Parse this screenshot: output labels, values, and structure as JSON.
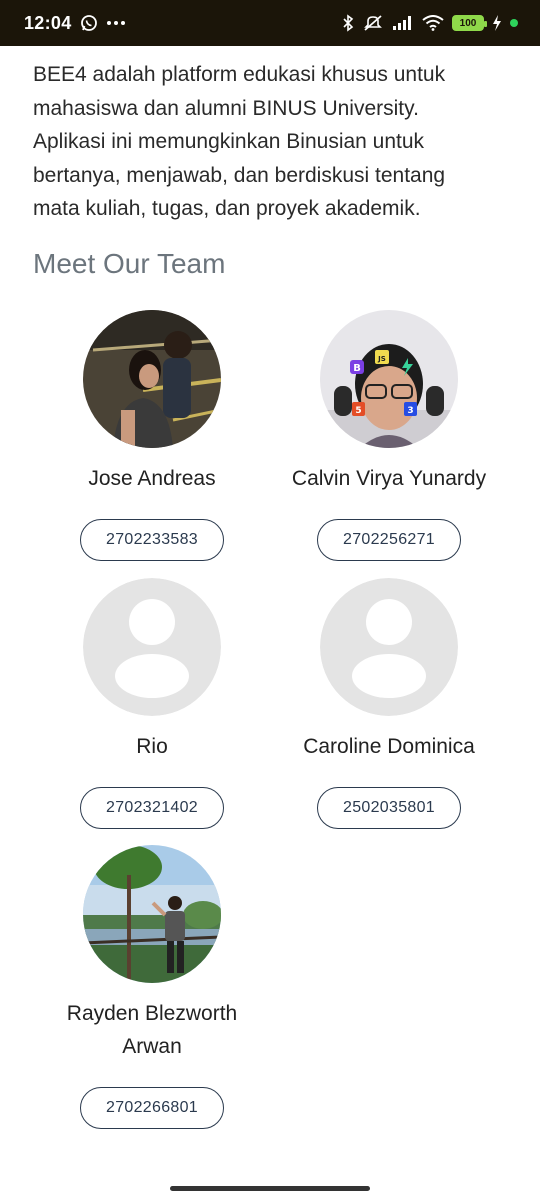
{
  "status_bar": {
    "time": "12:04",
    "battery_level": "100",
    "icons": [
      "whatsapp-icon",
      "more-icon",
      "bluetooth-icon",
      "mute-icon",
      "signal-icon",
      "wifi-icon",
      "battery-icon",
      "charging-icon"
    ]
  },
  "about": {
    "text": "BEE4 adalah platform edukasi khusus untuk mahasiswa dan alumni BINUS University. Aplikasi ini memungkinkan Binusian untuk bertanya, menjawab, dan berdiskusi tentang mata kuliah, tugas, dan proyek akademik."
  },
  "team": {
    "title": "Meet Our Team",
    "members": [
      {
        "name": "Jose Andreas",
        "nim": "2702233583",
        "photo": "photo"
      },
      {
        "name": "Calvin Virya Yunardy",
        "nim": "2702256271",
        "photo": "photo"
      },
      {
        "name": "Rio",
        "nim": "2702321402",
        "photo": "placeholder"
      },
      {
        "name": "Caroline Dominica",
        "nim": "2502035801",
        "photo": "placeholder"
      },
      {
        "name": "Rayden Blezworth Arwan",
        "nim": "2702266801",
        "photo": "photo"
      }
    ]
  },
  "colors": {
    "status_bar_bg": "#1b1509",
    "title_gray": "#6c757d",
    "badge_border": "#2b3a4e",
    "placeholder_bg": "#e4e4e4"
  }
}
